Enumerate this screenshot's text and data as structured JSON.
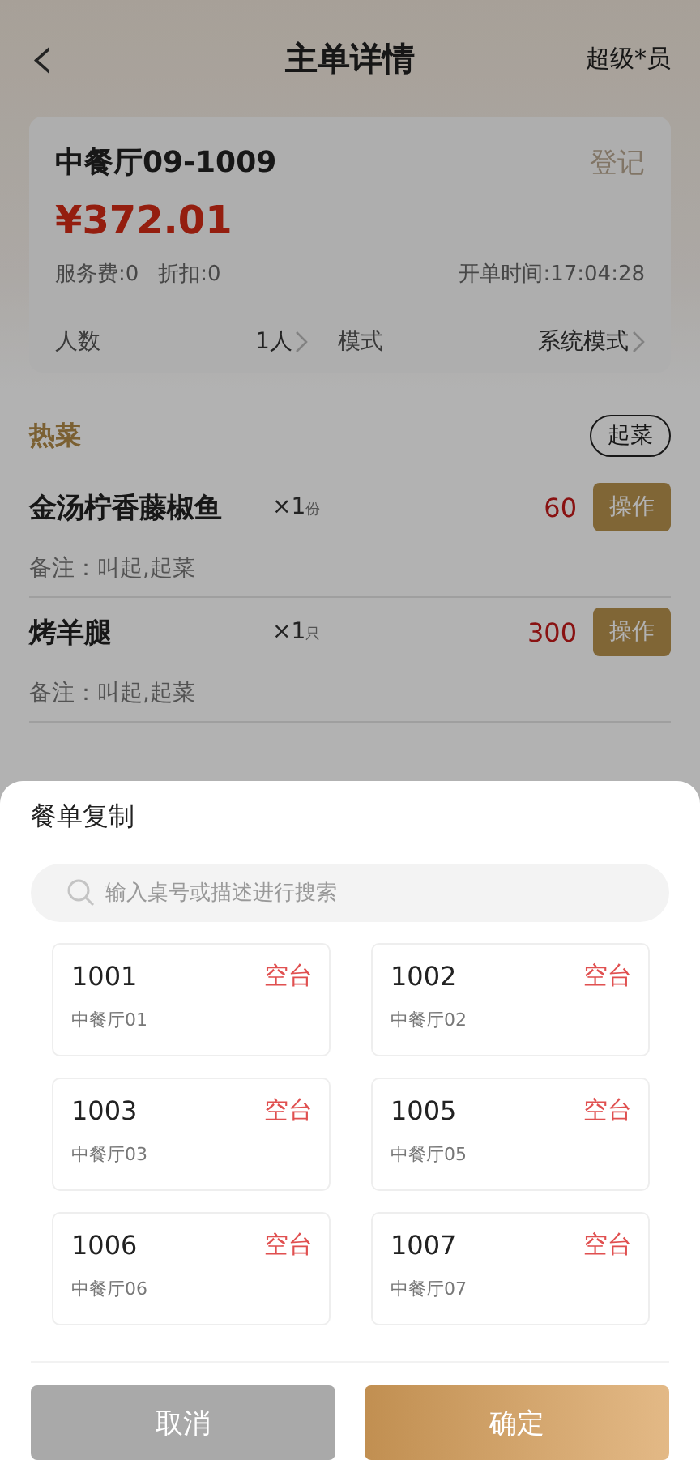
{
  "header": {
    "back": "‹",
    "title": "主单详情",
    "user": "超级*员"
  },
  "order": {
    "table": "中餐厅09-1009",
    "action": "登记",
    "amount": "¥372.01",
    "service_fee": "服务费:0",
    "discount": "折扣:0",
    "open_time": "开单时间:17:04:28",
    "guests_label": "人数",
    "guests_value": "1人",
    "mode_label": "模式",
    "mode_value": "系统模式"
  },
  "section": {
    "title": "热菜",
    "action": "起菜"
  },
  "dishes": [
    {
      "name": "金汤柠香藤椒鱼",
      "qty": "×1",
      "unit": "份",
      "price": "60",
      "button": "操作",
      "note": "备注：叫起,起菜"
    },
    {
      "name": "烤羊腿",
      "qty": "×1",
      "unit": "只",
      "price": "300",
      "button": "操作",
      "note": "备注：叫起,起菜"
    }
  ],
  "sheet": {
    "title": "餐单复制",
    "search": {
      "placeholder": "输入桌号或描述进行搜索"
    },
    "tables": [
      {
        "number": "1001",
        "status": "空台",
        "area": "中餐厅01"
      },
      {
        "number": "1002",
        "status": "空台",
        "area": "中餐厅02"
      },
      {
        "number": "1003",
        "status": "空台",
        "area": "中餐厅03"
      },
      {
        "number": "1005",
        "status": "空台",
        "area": "中餐厅05"
      },
      {
        "number": "1006",
        "status": "空台",
        "area": "中餐厅06"
      },
      {
        "number": "1007",
        "status": "空台",
        "area": "中餐厅07"
      }
    ],
    "buttons": [
      {
        "label": "取消",
        "kind": "cancel"
      },
      {
        "label": "确定",
        "kind": "confirm"
      }
    ]
  }
}
